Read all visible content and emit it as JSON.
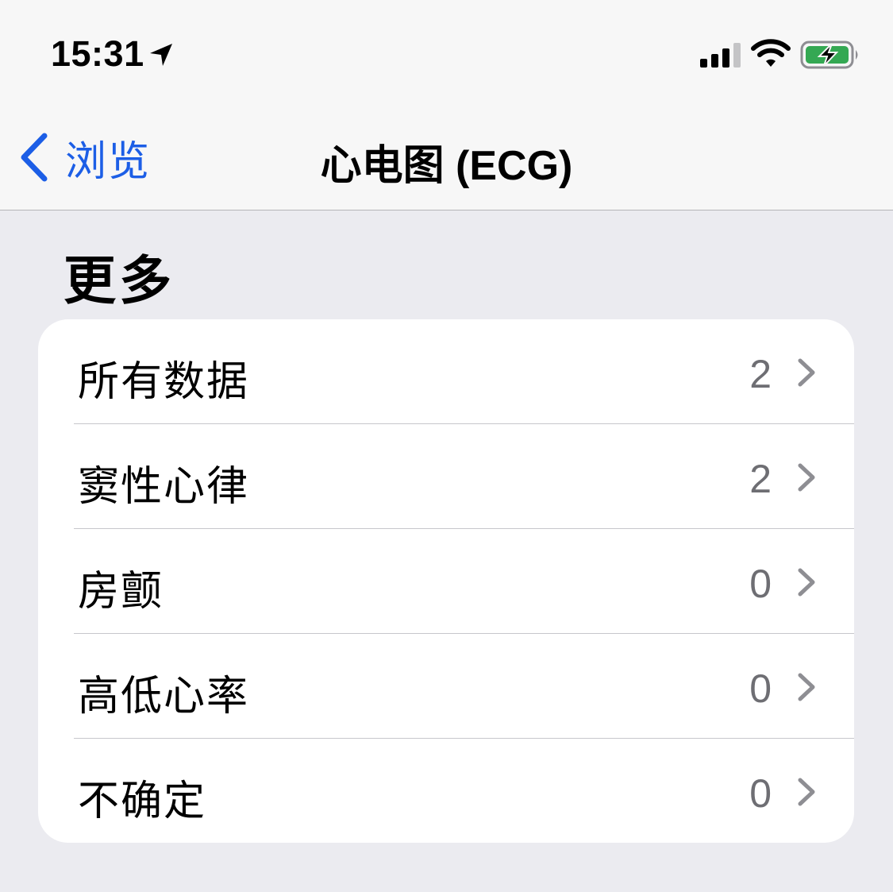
{
  "status_bar": {
    "time": "15:31",
    "icons": [
      "location-arrow-icon",
      "cellular-signal-icon",
      "wifi-icon",
      "battery-charging-icon"
    ],
    "battery_color": "#34a853"
  },
  "nav": {
    "back_label": "浏览",
    "title": "心电图 (ECG)",
    "accent_color": "#1c5ee6"
  },
  "section": {
    "header": "更多",
    "rows": [
      {
        "label": "所有数据",
        "count": "2"
      },
      {
        "label": "窦性心律",
        "count": "2"
      },
      {
        "label": "房颤",
        "count": "0"
      },
      {
        "label": "高低心率",
        "count": "0"
      },
      {
        "label": "不确定",
        "count": "0"
      }
    ]
  }
}
